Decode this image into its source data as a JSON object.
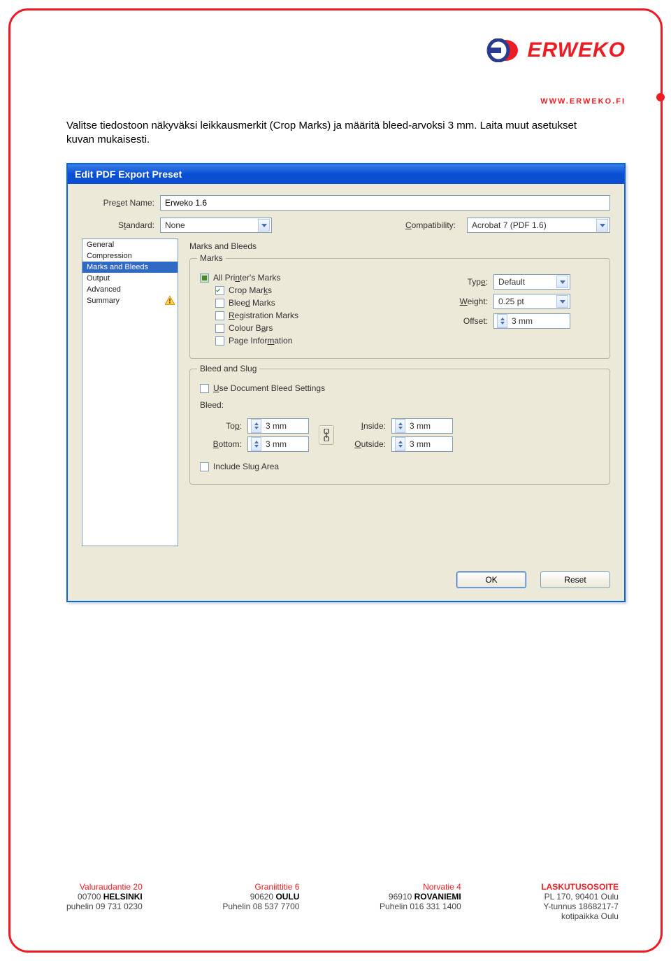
{
  "brand": {
    "name": "ERWEKO",
    "url": "WWW.ERWEKO.FI"
  },
  "intro": "Valitse tiedostoon näkyväksi leikkausmerkit (Crop Marks) ja määritä bleed-arvoksi 3 mm. Laita muut asetukset kuvan mukaisesti.",
  "dialog": {
    "title": "Edit PDF Export Preset",
    "labels": {
      "preset_name": "Preset Name:",
      "standard": "Standard:",
      "compatibility": "Compatibility:"
    },
    "preset_name": "Erweko 1.6",
    "standard": "None",
    "compatibility": "Acrobat 7 (PDF 1.6)",
    "sidebar": [
      "General",
      "Compression",
      "Marks and Bleeds",
      "Output",
      "Advanced",
      "Summary"
    ],
    "panel_title": "Marks and Bleeds",
    "marks_group": {
      "legend": "Marks",
      "all": "All Printer's Marks",
      "crop": "Crop Marks",
      "bleed": "Bleed Marks",
      "reg": "Registration Marks",
      "colour": "Colour Bars",
      "pageinfo": "Page Information",
      "type_label": "Type:",
      "type_value": "Default",
      "weight_label": "Weight:",
      "weight_value": "0.25 pt",
      "offset_label": "Offset:",
      "offset_value": "3 mm"
    },
    "bleed_group": {
      "legend": "Bleed and Slug",
      "use_doc": "Use Document Bleed Settings",
      "bleed_label": "Bleed:",
      "top_label": "Top:",
      "bottom_label": "Bottom:",
      "inside_label": "Inside:",
      "outside_label": "Outside:",
      "top": "3 mm",
      "bottom": "3 mm",
      "inside": "3 mm",
      "outside": "3 mm",
      "slug": "Include Slug Area"
    },
    "buttons": {
      "ok": "OK",
      "reset": "Reset"
    }
  },
  "footer": {
    "col1": {
      "street": "Valuraudantie 20",
      "zip": "00700",
      "city": "HELSINKI",
      "phone": "puhelin 09 731 0230"
    },
    "col2": {
      "street": "Graniittitie 6",
      "zip": "90620",
      "city": "OULU",
      "phone": "Puhelin 08 537 7700"
    },
    "col3": {
      "street": "Norvatie 4",
      "zip": "96910",
      "city": "ROVANIEMI",
      "phone": "Puhelin 016 331 1400"
    },
    "col4": {
      "header": "LASKUTUSOSOITE",
      "line1": "PL 170, 90401 Oulu",
      "line2": "Y-tunnus 1868217-7",
      "line3": "kotipaikka Oulu"
    }
  }
}
